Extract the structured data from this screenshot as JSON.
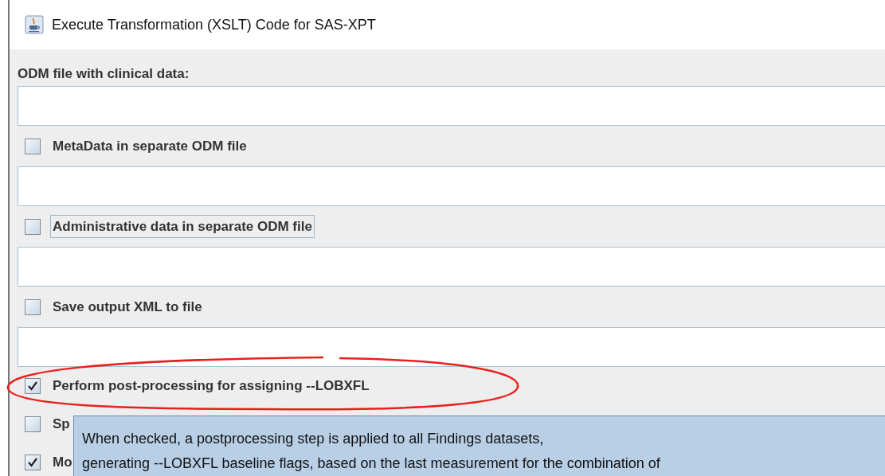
{
  "window": {
    "title": "Execute Transformation (XSLT) Code for SAS-XPT"
  },
  "odm_field": {
    "label": "ODM file with clinical data:"
  },
  "options": [
    {
      "kind": "file",
      "label": "MetaData in separate ODM file",
      "checked": false,
      "focused": false
    },
    {
      "kind": "file",
      "label": "Administrative data in separate ODM file",
      "checked": false,
      "focused": true
    },
    {
      "kind": "file",
      "label": "Save output XML to file",
      "checked": false,
      "focused": false
    },
    {
      "kind": "flag",
      "label": "Perform post-processing for assigning --LOBXFL",
      "checked": true,
      "focused": false
    },
    {
      "kind": "flag",
      "label": "Sp",
      "checked": false,
      "focused": false
    },
    {
      "kind": "flag",
      "label": "Mo",
      "checked": true,
      "focused": false
    }
  ],
  "tooltip": {
    "lines": [
      "When checked, a postprocessing step is applied to all Findings datasets,",
      "generating --LOBXFL baseline flags, based on the last measurement for the combination of"
    ]
  }
}
